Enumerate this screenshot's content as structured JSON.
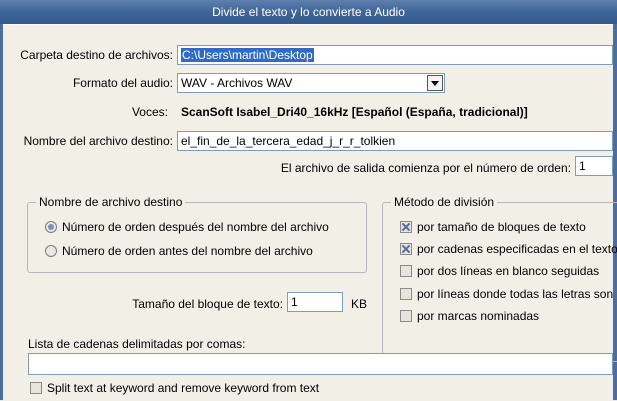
{
  "window": {
    "title": "Divide el texto y lo convierte a Audio"
  },
  "form": {
    "folder_label": "Carpeta destino de archivos:",
    "folder_value": "C:\\Users\\martin\\Desktop",
    "format_label": "Formato del audio:",
    "format_value": "WAV - Archivos WAV",
    "voices_label": "Voces:",
    "voices_value": "ScanSoft Isabel_Dri40_16kHz [Español (España, tradicional)]",
    "filename_label": "Nombre del archivo destino:",
    "filename_value": "el_fin_de_la_tercera_edad_j_r_r_tolkien",
    "order_start_label": "El archivo de salida comienza por el número de orden:",
    "order_start_value": "1",
    "block_size_label": "Tamaño del bloque de texto:",
    "block_size_value": "1",
    "block_size_unit": "KB",
    "strings_label": "Lista de cadenas delimitadas por comas:",
    "strings_value": "",
    "split_keyword_label": "Split text at keyword and remove keyword from text"
  },
  "naming_group": {
    "title": "Nombre de archivo destino",
    "options": [
      {
        "label": "Número de orden después del nombre del archivo",
        "selected": true
      },
      {
        "label": "Número de orden antes del nombre del archivo",
        "selected": false
      }
    ]
  },
  "method_group": {
    "title": "Método de división",
    "options": [
      {
        "label": "por tamaño de bloques de texto",
        "checked": true
      },
      {
        "label": "por cadenas especificadas en el texto de e",
        "checked": true
      },
      {
        "label": "por dos líneas en blanco seguidas",
        "checked": false
      },
      {
        "label": "por líneas donde todas las letras son mayú",
        "checked": false
      },
      {
        "label": "por marcas nominadas",
        "checked": false
      }
    ]
  }
}
